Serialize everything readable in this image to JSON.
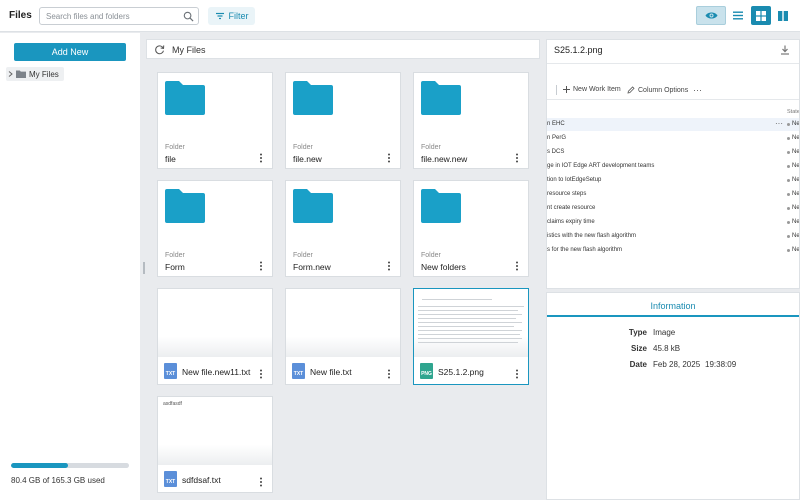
{
  "app": {
    "title": "Files"
  },
  "search": {
    "placeholder": "Search files and folders",
    "icon": "search-icon"
  },
  "toolbar": {
    "filter_label": "Filter",
    "views": [
      "eye-icon",
      "list-icon",
      "grid-icon",
      "split-icon"
    ],
    "active_view": "grid-icon"
  },
  "colors": {
    "accent": "#1a96bf",
    "folder": "#1aa0c8",
    "txt_badge": "#5b8fd9",
    "png_badge": "#2fa58f"
  },
  "sidebar": {
    "add_new_label": "Add New",
    "tree": [
      {
        "label": "My Files"
      }
    ],
    "storage": {
      "text": "80.4 GB of 165.3 GB used",
      "used_fraction": 0.486
    }
  },
  "main": {
    "title": "My Files",
    "folders": [
      {
        "type": "Folder",
        "name": "file"
      },
      {
        "type": "Folder",
        "name": "file.new"
      },
      {
        "type": "Folder",
        "name": "file.new.new"
      },
      {
        "type": "Folder",
        "name": "Form"
      },
      {
        "type": "Folder",
        "name": "Form.new"
      },
      {
        "type": "Folder",
        "name": "New folders"
      }
    ],
    "files": [
      {
        "badge": "TXT",
        "name": "New file.new11.txt",
        "thumb_text": ""
      },
      {
        "badge": "TXT",
        "name": "New file.txt",
        "thumb_text": ""
      },
      {
        "badge": "PNG",
        "name": "S25.1.2.png",
        "thumb_text": ""
      },
      {
        "badge": "TXT",
        "name": "sdfdsaf.txt",
        "thumb_text": "asdfasdf"
      }
    ]
  },
  "preview": {
    "title": "S25.1.2.png",
    "toolbar": {
      "new_work_item": "New Work Item",
      "column_options": "Column Options",
      "more": "⋯"
    },
    "column_header": "State",
    "rows": [
      {
        "text": "n EHC",
        "state": "New"
      },
      {
        "text": "n PerG",
        "state": "New"
      },
      {
        "text": "s DCS",
        "state": "New"
      },
      {
        "text": "ge in IOT Edge ART development teams",
        "state": "New"
      },
      {
        "text": "tion to IotEdgeSetup",
        "state": "New"
      },
      {
        "text": "resource steps",
        "state": "New"
      },
      {
        "text": "nt create resource",
        "state": "New"
      },
      {
        "text": "claims expiry time",
        "state": "New"
      },
      {
        "text": "istics with the new flash algorithm",
        "state": "New"
      },
      {
        "text": "s for the new flash algorithm",
        "state": "New"
      }
    ]
  },
  "info": {
    "title": "Information",
    "type_label": "Type",
    "type_value": "Image",
    "size_label": "Size",
    "size_value": "45.8 kB",
    "date_label": "Date",
    "date_value": "Feb 28, 2025",
    "time_value": "19:38:09"
  }
}
